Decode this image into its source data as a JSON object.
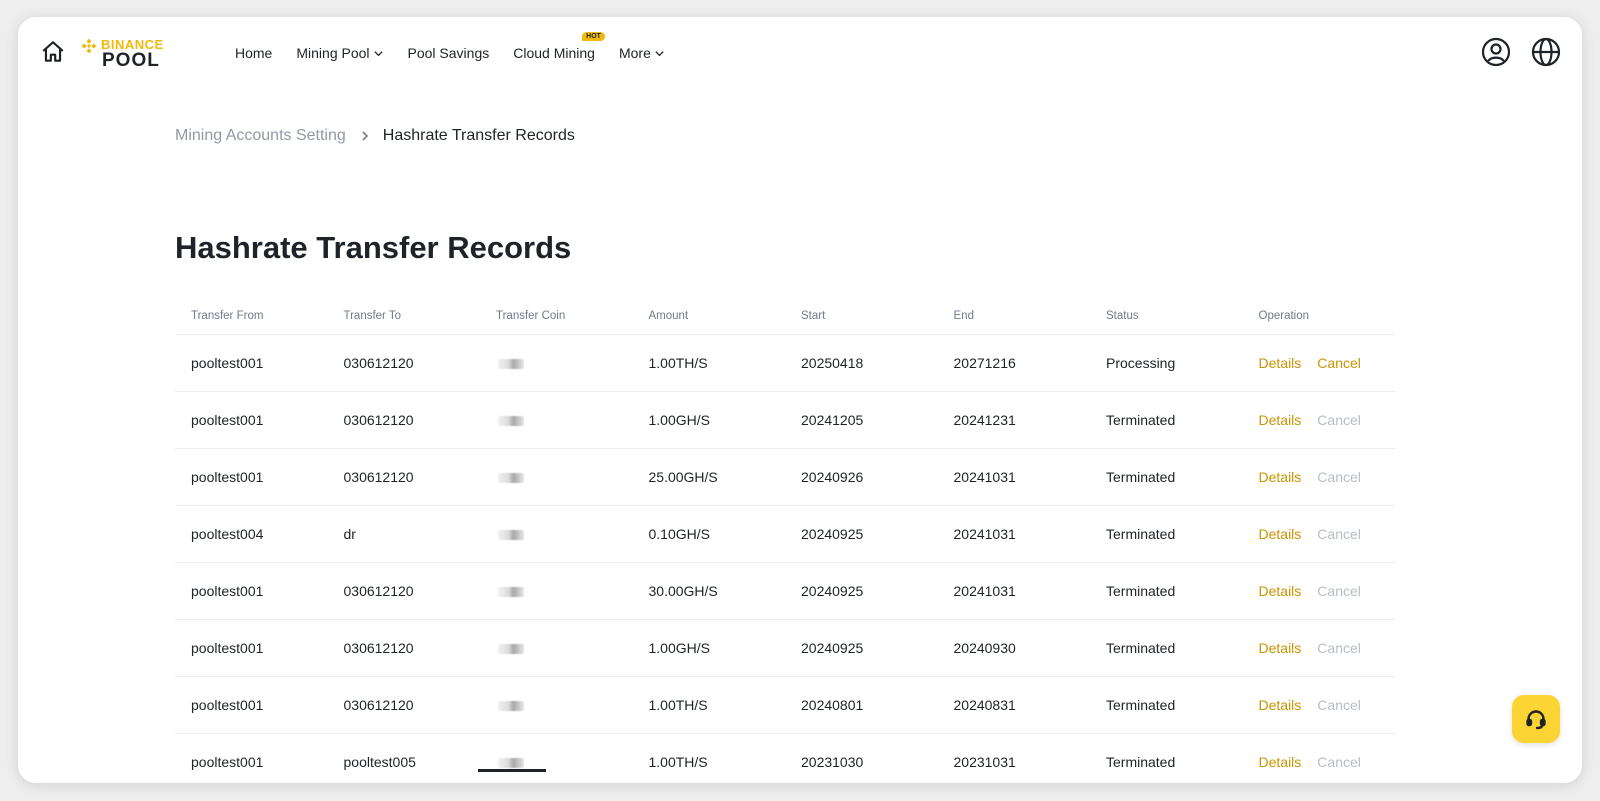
{
  "header": {
    "logo": {
      "brand": "BINANCE",
      "product": "POOL"
    },
    "nav": [
      {
        "label": "Home",
        "has_dropdown": false,
        "badge": ""
      },
      {
        "label": "Mining Pool",
        "has_dropdown": true,
        "badge": ""
      },
      {
        "label": "Pool Savings",
        "has_dropdown": false,
        "badge": ""
      },
      {
        "label": "Cloud Mining",
        "has_dropdown": false,
        "badge": "HOT"
      },
      {
        "label": "More",
        "has_dropdown": true,
        "badge": ""
      }
    ],
    "icons": [
      "home-icon",
      "account-icon",
      "globe-icon"
    ]
  },
  "breadcrumb": {
    "parent": "Mining Accounts Setting",
    "current": "Hashrate Transfer Records"
  },
  "page_title": "Hashrate Transfer Records",
  "table": {
    "columns": [
      "Transfer From",
      "Transfer To",
      "Transfer Coin",
      "Amount",
      "Start",
      "End",
      "Status",
      "Operation"
    ],
    "rows": [
      {
        "from": "pooltest001",
        "to": "030612120",
        "amount": "1.00TH/S",
        "start": "20250418",
        "end": "20271216",
        "status": "Processing",
        "details": "Details",
        "cancel": "Cancel",
        "cancel_enabled": true
      },
      {
        "from": "pooltest001",
        "to": "030612120",
        "amount": "1.00GH/S",
        "start": "20241205",
        "end": "20241231",
        "status": "Terminated",
        "details": "Details",
        "cancel": "Cancel",
        "cancel_enabled": false
      },
      {
        "from": "pooltest001",
        "to": "030612120",
        "amount": "25.00GH/S",
        "start": "20240926",
        "end": "20241031",
        "status": "Terminated",
        "details": "Details",
        "cancel": "Cancel",
        "cancel_enabled": false
      },
      {
        "from": "pooltest004",
        "to": "dr",
        "amount": "0.10GH/S",
        "start": "20240925",
        "end": "20241031",
        "status": "Terminated",
        "details": "Details",
        "cancel": "Cancel",
        "cancel_enabled": false
      },
      {
        "from": "pooltest001",
        "to": "030612120",
        "amount": "30.00GH/S",
        "start": "20240925",
        "end": "20241031",
        "status": "Terminated",
        "details": "Details",
        "cancel": "Cancel",
        "cancel_enabled": false
      },
      {
        "from": "pooltest001",
        "to": "030612120",
        "amount": "1.00GH/S",
        "start": "20240925",
        "end": "20240930",
        "status": "Terminated",
        "details": "Details",
        "cancel": "Cancel",
        "cancel_enabled": false
      },
      {
        "from": "pooltest001",
        "to": "030612120",
        "amount": "1.00TH/S",
        "start": "20240801",
        "end": "20240831",
        "status": "Terminated",
        "details": "Details",
        "cancel": "Cancel",
        "cancel_enabled": false
      },
      {
        "from": "pooltest001",
        "to": "pooltest005",
        "amount": "1.00TH/S",
        "start": "20231030",
        "end": "20231031",
        "status": "Terminated",
        "details": "Details",
        "cancel": "Cancel",
        "cancel_enabled": false
      }
    ]
  },
  "support_button": {
    "icon": "headset-icon"
  },
  "colors": {
    "accent": "#f0b90b",
    "link": "#c99400",
    "disabled": "#b7bdc6",
    "muted": "#929aa5",
    "chat_bg": "#fcd535"
  }
}
